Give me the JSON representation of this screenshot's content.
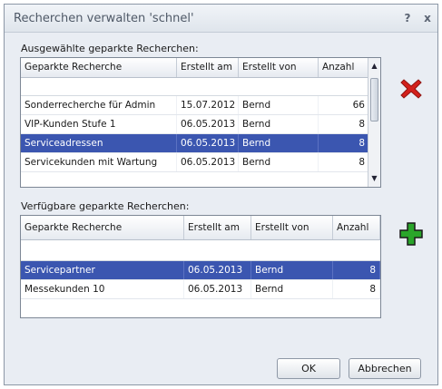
{
  "window": {
    "title": "Recherchen verwalten 'schnel'",
    "help_glyph": "?",
    "close_glyph": "x"
  },
  "selected_section": {
    "label": "Ausgewählte geparkte Recherchen:",
    "columns": [
      "Geparkte Recherche",
      "Erstellt am",
      "Erstellt von",
      "Anzahl"
    ],
    "rows": [
      {
        "name": "Sonderrecherche für Admin",
        "date": "15.07.2012",
        "user": "Bernd",
        "count": "66"
      },
      {
        "name": "VIP-Kunden Stufe 1",
        "date": "06.05.2013",
        "user": "Bernd",
        "count": "8"
      },
      {
        "name": "Serviceadressen",
        "date": "06.05.2013",
        "user": "Bernd",
        "count": "8",
        "selected": true
      },
      {
        "name": "Servicekunden mit Wartung",
        "date": "06.05.2013",
        "user": "Bernd",
        "count": "8"
      }
    ]
  },
  "available_section": {
    "label": "Verfügbare geparkte Recherchen:",
    "columns": [
      "Geparkte Recherche",
      "Erstellt am",
      "Erstellt von",
      "Anzahl"
    ],
    "rows": [
      {
        "name": "Servicepartner",
        "date": "06.05.2013",
        "user": "Bernd",
        "count": "8",
        "selected": true
      },
      {
        "name": "Messekunden 10",
        "date": "06.05.2013",
        "user": "Bernd",
        "count": "8"
      }
    ]
  },
  "buttons": {
    "ok": "OK",
    "cancel": "Abbrechen"
  },
  "icons": {
    "remove": "red-x-icon",
    "add": "green-plus-icon"
  },
  "colors": {
    "selection": "#3b56b0",
    "remove_red": "#d3201b",
    "add_green": "#2aa52a"
  }
}
